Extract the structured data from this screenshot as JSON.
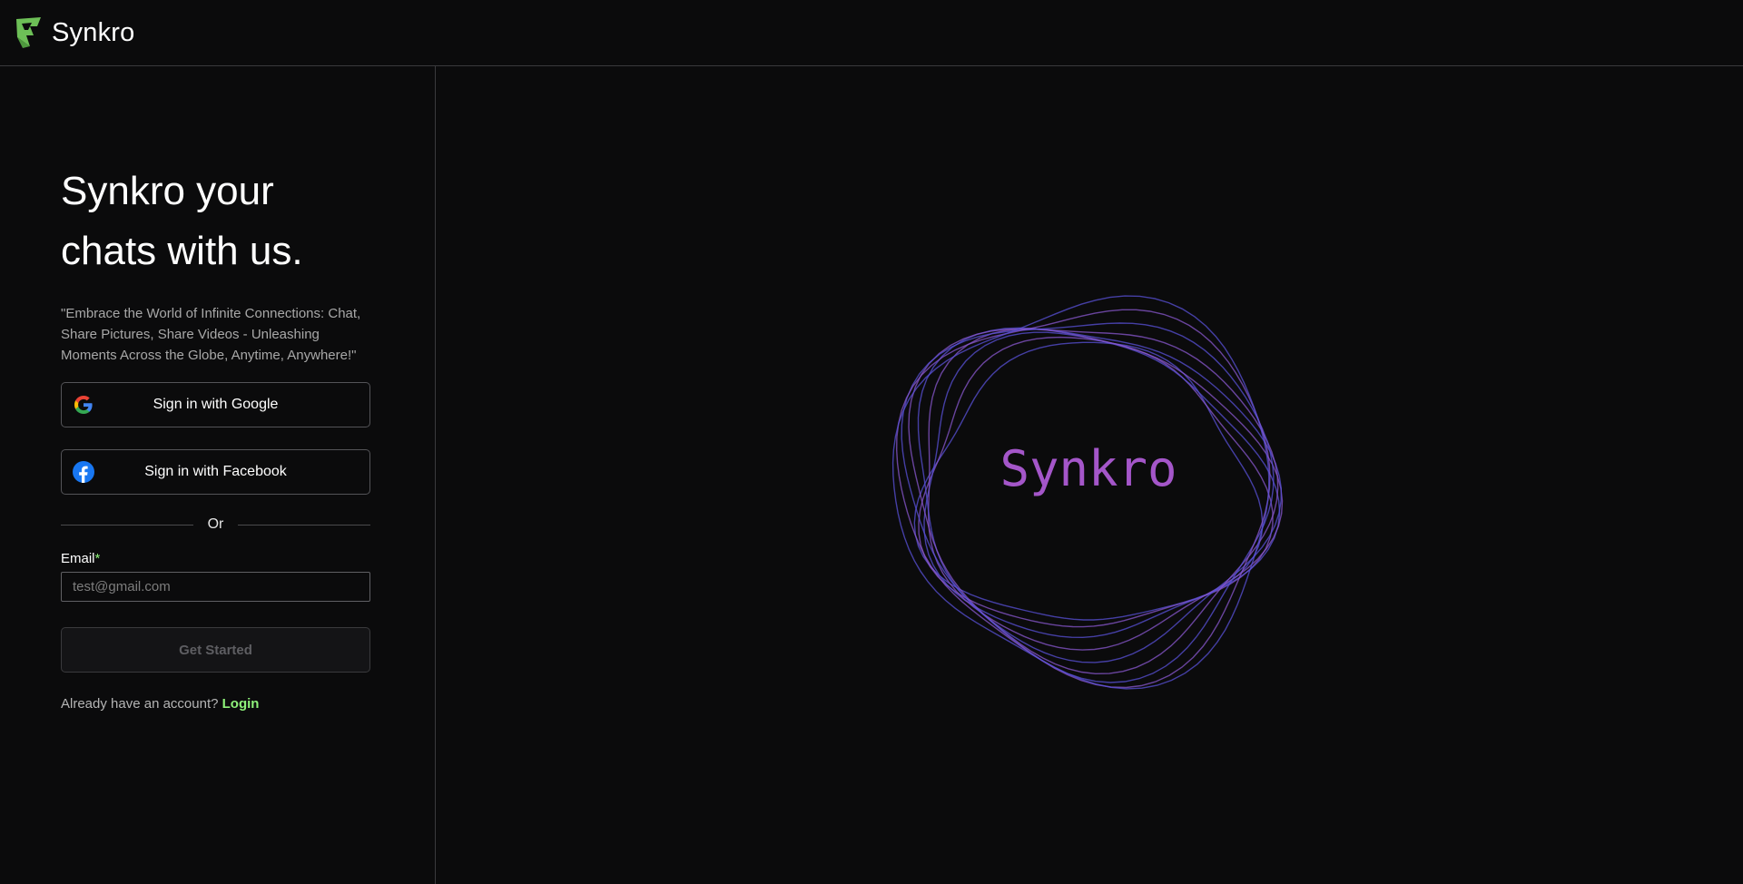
{
  "header": {
    "brand": "Synkro",
    "logo_icon": "synkro-logo-icon"
  },
  "auth": {
    "headline": "Synkro your chats with us.",
    "quote": "\"Embrace the World of Infinite Connections: Chat, Share Pictures, Share Videos - Unleashing Moments Across the Globe, Anytime, Anywhere!\"",
    "google_label": "Sign in with Google",
    "google_icon": "google-icon",
    "facebook_label": "Sign in with Facebook",
    "facebook_icon": "facebook-icon",
    "divider_text": "Or",
    "email_label": "Email",
    "email_required_mark": "*",
    "email_placeholder": "test@gmail.com",
    "email_value": "",
    "cta_label": "Get Started",
    "account_prompt": "Already have an account?",
    "login_label": "Login"
  },
  "hero": {
    "brand_text": "Synkro"
  },
  "colors": {
    "background": "#0b0b0c",
    "accent_green": "#8ef27a",
    "hero_text": "#a456c9",
    "ring_blue": "#5a52d8",
    "ring_purple": "#8a58cf"
  }
}
